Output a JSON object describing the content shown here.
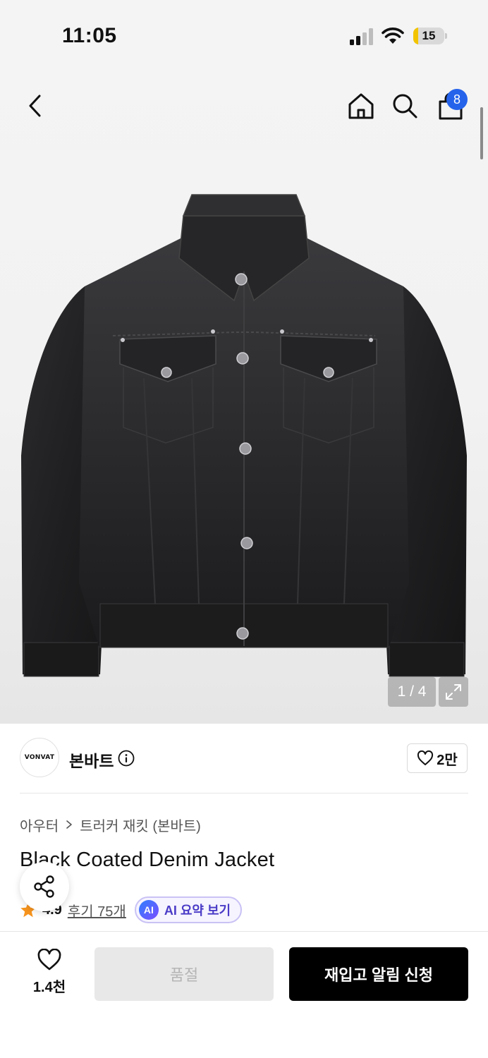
{
  "status_bar": {
    "time": "11:05",
    "battery_level": "15",
    "battery_fraction": 0.15,
    "battery_color": "#f2c400"
  },
  "nav": {
    "back_icon": "chevron-left-icon",
    "home_icon": "home-icon",
    "search_icon": "search-icon",
    "cart_icon": "shopping-bag-icon",
    "cart_count": "8",
    "badge_color": "#2563eb"
  },
  "gallery": {
    "counter": "1 / 4",
    "expand_icon": "expand-icon"
  },
  "brand": {
    "logo_text": "VONVAT",
    "name": "본바트",
    "info_icon": "info-icon",
    "like_count": "2만"
  },
  "breadcrumb": {
    "category": "아우터",
    "subcategory": "트러커 재킷 (본바트)"
  },
  "product": {
    "title": "Black Coated Denim Jacket",
    "rating": "4.9",
    "review_label": "후기 75개",
    "ai_badge": "AI",
    "ai_summary_label": "AI 요약 보기",
    "star_color": "#f7941d"
  },
  "bottom_bar": {
    "wish_count": "1.4천",
    "soldout_label": "품절",
    "restock_label": "재입고 알림 신청"
  }
}
